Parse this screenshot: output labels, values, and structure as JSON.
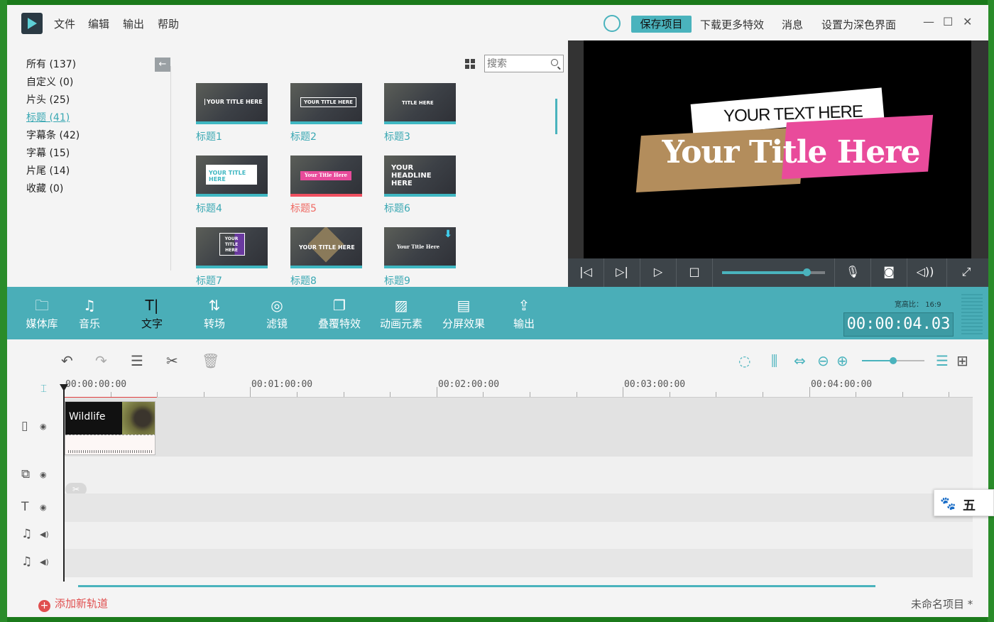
{
  "menu": [
    "文件",
    "编辑",
    "输出",
    "帮助"
  ],
  "header": {
    "save_project": "保存项目",
    "download_effects": "下载更多特效",
    "messages": "消息",
    "dark_mode": "设置为深色界面"
  },
  "window_controls": {
    "minimize": "—",
    "maximize": "☐",
    "close": "✕"
  },
  "categories": [
    {
      "label": "所有 (137)"
    },
    {
      "label": "自定义 (0)"
    },
    {
      "label": "片头 (25)"
    },
    {
      "label": "标题 (41)",
      "active": true
    },
    {
      "label": "字幕条 (42)"
    },
    {
      "label": "字幕 (15)"
    },
    {
      "label": "片尾 (14)"
    },
    {
      "label": "收藏 (0)"
    }
  ],
  "search": {
    "placeholder": "搜索"
  },
  "thumbnails": [
    {
      "label": "标题1",
      "caption": "YOUR TITLE HERE"
    },
    {
      "label": "标题2",
      "caption": "YOUR TITLE HERE"
    },
    {
      "label": "标题3",
      "caption": "TITLE HERE"
    },
    {
      "label": "标题4",
      "caption": "YOUR TITLE HERE"
    },
    {
      "label": "标题5",
      "caption": "Your Title Here",
      "selected": true
    },
    {
      "label": "标题6",
      "caption": "YOUR HEADLINE HERE"
    },
    {
      "label": "标题7",
      "caption": "YOUR TITLE HERE"
    },
    {
      "label": "标题8",
      "caption": "YOUR TITLE HERE"
    },
    {
      "label": "标题9",
      "caption": "Your Title Here"
    }
  ],
  "preview": {
    "subtitle": "YOUR TEXT HERE",
    "title": "Your Title Here",
    "progress": 0.82
  },
  "toolbar": [
    {
      "label": "媒体库",
      "icon": "folder-icon"
    },
    {
      "label": "音乐",
      "icon": "music-icon"
    },
    {
      "label": "文字",
      "icon": "text-icon",
      "active": true
    },
    {
      "label": "转场",
      "icon": "transition-icon"
    },
    {
      "label": "滤镜",
      "icon": "filter-icon"
    },
    {
      "label": "叠覆特效",
      "icon": "overlay-icon"
    },
    {
      "label": "动画元素",
      "icon": "elements-icon"
    },
    {
      "label": "分屏效果",
      "icon": "split-screen-icon"
    },
    {
      "label": "输出",
      "icon": "export-icon"
    }
  ],
  "aspect_ratio": {
    "label": "宽高比：",
    "value": "16:9"
  },
  "timecode": "00:00:04.03",
  "ruler": [
    "00:00:00:00",
    "00:01:00:00",
    "00:02:00:00",
    "00:03:00:00",
    "00:04:00:00"
  ],
  "zoom_level": 0.5,
  "clip": {
    "name": "Wildlife"
  },
  "add_track": "添加新轨道",
  "project_name": "未命名项目 *",
  "ime": {
    "char": "五"
  },
  "colors": {
    "accent": "#4aaeb8",
    "red": "#e04f4f",
    "pink": "#e94b9b",
    "tan": "#b38d5c"
  }
}
